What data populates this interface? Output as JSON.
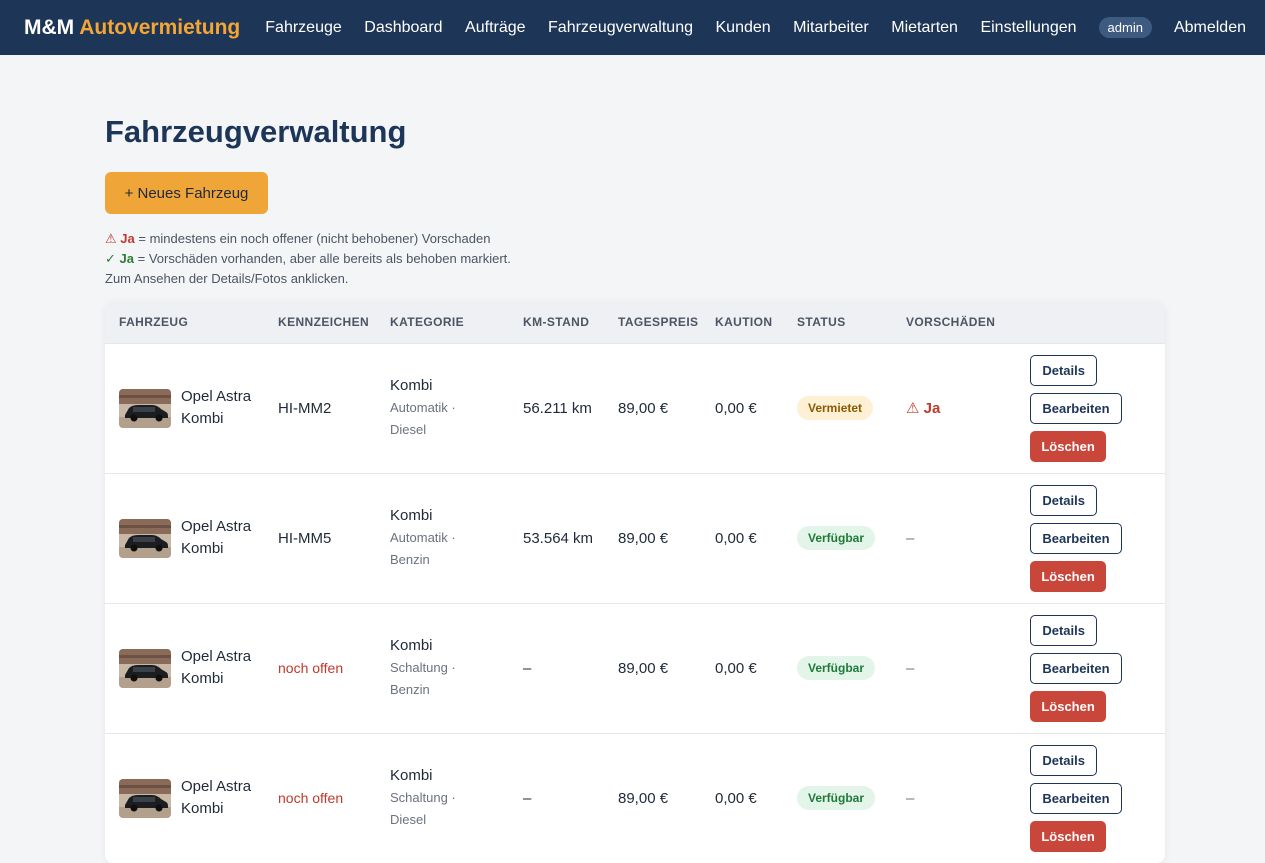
{
  "header": {
    "brand_main": "M&M",
    "brand_accent": "Autovermietung",
    "nav": [
      "Fahrzeuge",
      "Dashboard",
      "Aufträge",
      "Fahrzeugverwaltung",
      "Kunden",
      "Mitarbeiter",
      "Mietarten",
      "Einstellungen"
    ],
    "user": "admin",
    "logout": "Abmelden"
  },
  "page": {
    "title": "Fahrzeugverwaltung",
    "add_button": "+ Neues Fahrzeug",
    "legend": {
      "warn_symbol": "⚠",
      "warn_word": "Ja",
      "warn_text": " = mindestens ein noch offener (nicht behobener) Vorschaden",
      "ok_symbol": "✓",
      "ok_word": "Ja",
      "ok_text": " = Vorschäden vorhanden, aber alle bereits als behoben markiert.",
      "hint": "Zum Ansehen der Details/Fotos anklicken."
    }
  },
  "table": {
    "headers": [
      "FAHRZEUG",
      "KENNZEICHEN",
      "KATEGORIE",
      "KM-STAND",
      "TAGESPREIS",
      "KAUTION",
      "STATUS",
      "VORSCHÄDEN",
      ""
    ],
    "actions": {
      "details": "Details",
      "edit": "Bearbeiten",
      "delete": "Löschen"
    },
    "rows": [
      {
        "name": "Opel Astra Kombi",
        "plate": "HI-MM2",
        "plate_open": false,
        "category": "Kombi",
        "category_sub": "Automatik · Diesel",
        "km": "56.211 km",
        "price": "89,00 €",
        "deposit": "0,00 €",
        "status": "Vermietet",
        "status_type": "rented",
        "damage": "⚠ Ja",
        "damage_type": "open"
      },
      {
        "name": "Opel Astra Kombi",
        "plate": "HI-MM5",
        "plate_open": false,
        "category": "Kombi",
        "category_sub": "Automatik · Benzin",
        "km": "53.564 km",
        "price": "89,00 €",
        "deposit": "0,00 €",
        "status": "Verfügbar",
        "status_type": "available",
        "damage": "–",
        "damage_type": "none"
      },
      {
        "name": "Opel Astra Kombi",
        "plate": "noch offen",
        "plate_open": true,
        "category": "Kombi",
        "category_sub": "Schaltung · Benzin",
        "km": "–",
        "price": "89,00 €",
        "deposit": "0,00 €",
        "status": "Verfügbar",
        "status_type": "available",
        "damage": "–",
        "damage_type": "none"
      },
      {
        "name": "Opel Astra Kombi",
        "plate": "noch offen",
        "plate_open": true,
        "category": "Kombi",
        "category_sub": "Schaltung · Diesel",
        "km": "–",
        "price": "89,00 €",
        "deposit": "0,00 €",
        "status": "Verfügbar",
        "status_type": "available",
        "damage": "–",
        "damage_type": "none"
      }
    ]
  },
  "colors": {
    "header_bg": "#1d3557",
    "accent": "#f4a534",
    "danger": "#c9463b",
    "status_rented_bg": "#fdf0d5",
    "status_available_bg": "#e3f4e8"
  }
}
